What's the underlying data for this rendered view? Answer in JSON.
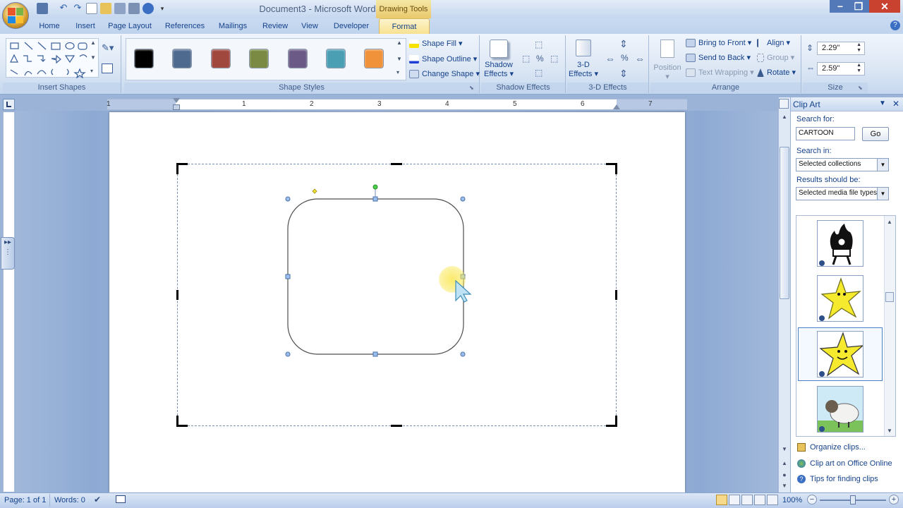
{
  "window": {
    "title": "Document3 - Microsoft Word",
    "context_tab": "Drawing Tools"
  },
  "tabs": [
    "Home",
    "Insert",
    "Page Layout",
    "References",
    "Mailings",
    "Review",
    "View",
    "Developer",
    "Format"
  ],
  "ribbon": {
    "groups": {
      "insert_shapes": "Insert Shapes",
      "shape_styles": "Shape Styles",
      "shadow_effects": "Shadow Effects",
      "three_d_effects": "3-D Effects",
      "arrange": "Arrange",
      "size": "Size"
    },
    "shape_style_swatches": [
      "#000000",
      "#4f6a8f",
      "#a0473e",
      "#7a8a43",
      "#6b5a86",
      "#4a9fb3",
      "#f0923a"
    ],
    "shape_fill": "Shape Fill",
    "shape_outline": "Shape Outline",
    "change_shape": "Change Shape",
    "shadow_effects_btn_line1": "Shadow",
    "shadow_effects_btn_line2": "Effects",
    "three_d_btn_line1": "3-D",
    "three_d_btn_line2": "Effects",
    "position": "Position",
    "bring_to_front": "Bring to Front",
    "send_to_back": "Send to Back",
    "text_wrapping": "Text Wrapping",
    "align": "Align",
    "group": "Group",
    "rotate": "Rotate",
    "height": "2.29\"",
    "width": "2.59\""
  },
  "ruler": {
    "numbers": [
      "1",
      "1",
      "2",
      "3",
      "4",
      "5",
      "6",
      "7"
    ]
  },
  "clip_art": {
    "title": "Clip Art",
    "search_for_label": "Search for:",
    "search_value": "CARTOON",
    "go": "Go",
    "search_in_label": "Search in:",
    "search_in_value": "Selected collections",
    "results_label": "Results should be:",
    "results_value": "Selected media file types",
    "links": [
      "Organize clips...",
      "Clip art on Office Online",
      "Tips for finding clips"
    ]
  },
  "status": {
    "page": "Page: 1 of 1",
    "words": "Words: 0",
    "zoom": "100%"
  }
}
